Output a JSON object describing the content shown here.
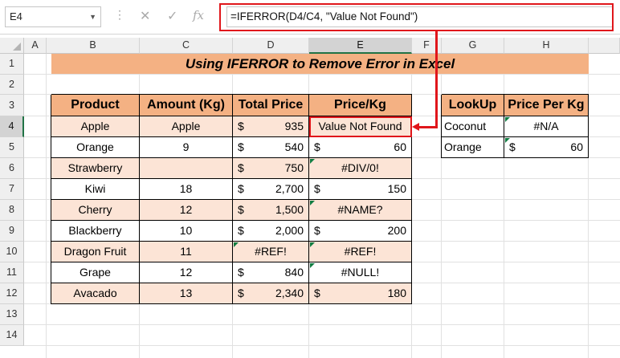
{
  "formula_bar": {
    "name_box": "E4",
    "formula": "=IFERROR(D4/C4, \"Value Not Found\")"
  },
  "columns": [
    "A",
    "B",
    "C",
    "D",
    "E",
    "F",
    "G",
    "H"
  ],
  "rows": [
    "1",
    "2",
    "3",
    "4",
    "5",
    "6",
    "7",
    "8",
    "9",
    "10",
    "11",
    "12",
    "13",
    "14"
  ],
  "title": "Using IFERROR to Remove Error in Excel",
  "main_table": {
    "headers": [
      "Product",
      "Amount (Kg)",
      "Total Price",
      "Price/Kg"
    ],
    "rows": [
      {
        "product": "Apple",
        "amount": "Apple",
        "total_cur": "$",
        "total": "935",
        "ppk_cur": "",
        "ppk": "Value Not Found"
      },
      {
        "product": "Orange",
        "amount": "9",
        "total_cur": "$",
        "total": "540",
        "ppk_cur": "$",
        "ppk": "60"
      },
      {
        "product": "Strawberry",
        "amount": "",
        "total_cur": "$",
        "total": "750",
        "ppk_cur": "",
        "ppk": "#DIV/0!"
      },
      {
        "product": "Kiwi",
        "amount": "18",
        "total_cur": "$",
        "total": "2,700",
        "ppk_cur": "$",
        "ppk": "150"
      },
      {
        "product": "Cherry",
        "amount": "12",
        "total_cur": "$",
        "total": "1,500",
        "ppk_cur": "",
        "ppk": "#NAME?"
      },
      {
        "product": "Blackberry",
        "amount": "10",
        "total_cur": "$",
        "total": "2,000",
        "ppk_cur": "$",
        "ppk": "200"
      },
      {
        "product": "Dragon Fruit",
        "amount": "11",
        "total_cur": "",
        "total": "#REF!",
        "ppk_cur": "",
        "ppk": "#REF!"
      },
      {
        "product": "Grape",
        "amount": "12",
        "total_cur": "$",
        "total": "840",
        "ppk_cur": "",
        "ppk": "#NULL!"
      },
      {
        "product": "Avacado",
        "amount": "13",
        "total_cur": "$",
        "total": "2,340",
        "ppk_cur": "$",
        "ppk": "180"
      }
    ]
  },
  "lookup_table": {
    "headers": [
      "LookUp",
      "Price Per Kg"
    ],
    "rows": [
      {
        "lookup": "Coconut",
        "cur": "",
        "value": "#N/A"
      },
      {
        "lookup": "Orange",
        "cur": "$",
        "value": "60"
      }
    ]
  },
  "colors": {
    "header_fill": "#f4b183",
    "row_fill": "#fce4d6",
    "highlight": "#e0161b",
    "error_marker": "#107c41"
  }
}
